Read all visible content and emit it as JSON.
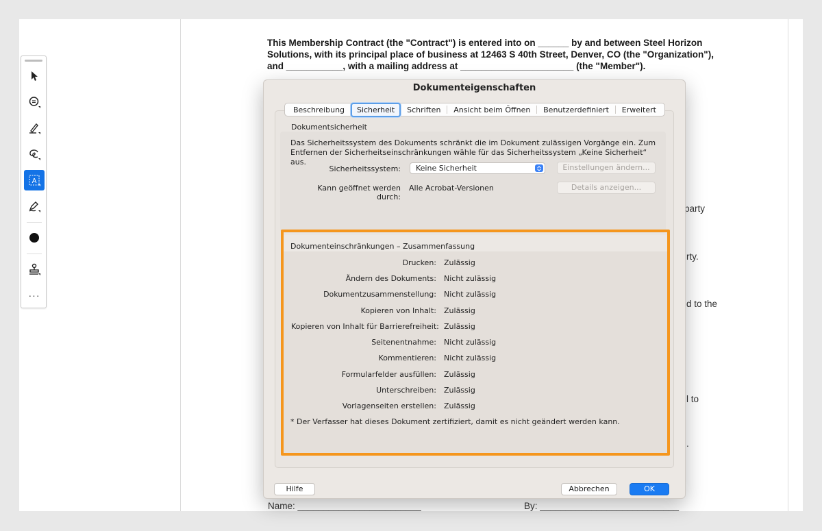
{
  "toolbar": {
    "tools": [
      {
        "name": "select-tool",
        "icon": "cursor-arrow-icon"
      },
      {
        "name": "comment-tool",
        "icon": "comment-bubble-icon"
      },
      {
        "name": "highlight-tool",
        "icon": "pen-highlight-icon"
      },
      {
        "name": "draw-tool",
        "icon": "freehand-loop-icon"
      },
      {
        "name": "text-recognition-tool",
        "icon": "text-box-icon",
        "label": "A",
        "active": true
      },
      {
        "name": "sign-tool",
        "icon": "signature-pen-icon"
      },
      {
        "name": "color-tool",
        "icon": "color-dot-icon"
      },
      {
        "name": "stamp-tool",
        "icon": "stamp-icon"
      }
    ],
    "more_label": "···"
  },
  "document": {
    "intro": "This Membership Contract (the \"Contract\") is entered into on ______ by and between Steel Horizon Solutions, with its principal place of business at 12463 S 40th Street, Denver, CO (the \"Organization\"), and ___________, with a mailing address at ______________________ (the \"Member\").",
    "fragments": [
      "party",
      "rty.",
      "d to the",
      "l to",
      "."
    ],
    "name_line": "Name: ________________________",
    "by_line": "By: ___________________________"
  },
  "dialog": {
    "title": "Dokumenteigenschaften",
    "tabs": [
      "Beschreibung",
      "Sicherheit",
      "Schriften",
      "Ansicht beim Öffnen",
      "Benutzerdefiniert",
      "Erweitert"
    ],
    "active_tab": "Sicherheit",
    "security_group_label": "Dokumentsicherheit",
    "security_description": "Das Sicherheitssystem des Dokuments schränkt die im Dokument zulässigen Vorgänge ein. Zum Entfernen der Sicherheitseinschränkungen wähle für das Sicherheitssystem „Keine Sicherheit“ aus.",
    "security_system_label": "Sicherheitssystem:",
    "security_system_value": "Keine Sicherheit",
    "change_settings_button": "Einstellungen ändern...",
    "opened_by_label": "Kann geöffnet werden durch:",
    "opened_by_value": "Alle Acrobat-Versionen",
    "show_details_button": "Details anzeigen...",
    "restrictions_title": "Dokumenteinschränkungen – Zusammenfassung",
    "restrictions": [
      {
        "label": "Drucken:",
        "value": "Zulässig"
      },
      {
        "label": "Ändern des Dokuments:",
        "value": "Nicht zulässig"
      },
      {
        "label": "Dokumentzusammenstellung:",
        "value": "Nicht zulässig"
      },
      {
        "label": "Kopieren von Inhalt:",
        "value": "Zulässig"
      },
      {
        "label": "Kopieren von Inhalt für Barrierefreiheit:",
        "value": "Zulässig"
      },
      {
        "label": "Seitenentnahme:",
        "value": "Nicht zulässig"
      },
      {
        "label": "Kommentieren:",
        "value": "Nicht zulässig"
      },
      {
        "label": "Formularfelder ausfüllen:",
        "value": "Zulässig"
      },
      {
        "label": "Unterschreiben:",
        "value": "Zulässig"
      },
      {
        "label": "Vorlagenseiten erstellen:",
        "value": "Zulässig"
      }
    ],
    "certified_note": "*   Der Verfasser hat dieses Dokument zertifiziert, damit es nicht geändert werden kann.",
    "help_button": "Hilfe",
    "cancel_button": "Abbrechen",
    "ok_button": "OK"
  },
  "colors": {
    "accent": "#1473e6",
    "highlight_border": "#f5961d",
    "ok_button": "#1a7bf2"
  }
}
